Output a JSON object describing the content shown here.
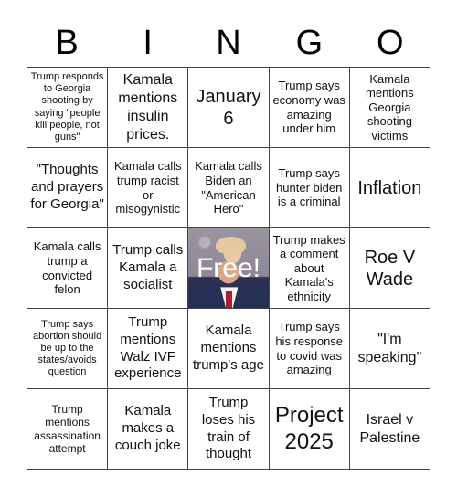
{
  "header": {
    "letters": [
      "B",
      "I",
      "N",
      "G",
      "O"
    ]
  },
  "board": {
    "rows": [
      [
        {
          "text": "Trump responds to Georgia shooting by saying \"people kill people, not guns\"",
          "size": "xs"
        },
        {
          "text": "Kamala mentions insulin prices.",
          "size": "md-lg"
        },
        {
          "text": "January 6",
          "size": "lg"
        },
        {
          "text": "Trump says economy was amazing under him",
          "size": "sm"
        },
        {
          "text": "Kamala mentions Georgia shooting victims",
          "size": "sm"
        }
      ],
      [
        {
          "text": "\"Thoughts and prayers for Georgia\"",
          "size": "md"
        },
        {
          "text": "Kamala calls trump racist or misogynistic",
          "size": "sm"
        },
        {
          "text": "Kamala calls Biden an \"American Hero\"",
          "size": "sm"
        },
        {
          "text": "Trump says hunter biden is a criminal",
          "size": "sm"
        },
        {
          "text": "Inflation",
          "size": "lg"
        }
      ],
      [
        {
          "text": "Kamala calls trump a convicted felon",
          "size": "sm"
        },
        {
          "text": "Trump calls Kamala a socialist",
          "size": "md"
        },
        {
          "text": "Free!",
          "size": "free",
          "free": true,
          "icon": "mugshot-portrait"
        },
        {
          "text": "Trump makes a comment about Kamala's ethnicity",
          "size": "sm"
        },
        {
          "text": "Roe V Wade",
          "size": "lg"
        }
      ],
      [
        {
          "text": "Trump says abortion should be up to the states/avoids question",
          "size": "xs"
        },
        {
          "text": "Trump mentions Walz IVF experience",
          "size": "md"
        },
        {
          "text": "Kamala mentions trump's age",
          "size": "md"
        },
        {
          "text": "Trump says his response to covid was amazing",
          "size": "sm"
        },
        {
          "text": "\"I'm speaking\"",
          "size": "md"
        }
      ],
      [
        {
          "text": "Trump mentions assassination attempt",
          "size": "sm"
        },
        {
          "text": "Kamala makes a couch joke",
          "size": "md"
        },
        {
          "text": "Trump loses his train of thought",
          "size": "md"
        },
        {
          "text": "Project 2025",
          "size": "xl"
        },
        {
          "text": "Israel v Palestine",
          "size": "md"
        }
      ]
    ]
  }
}
